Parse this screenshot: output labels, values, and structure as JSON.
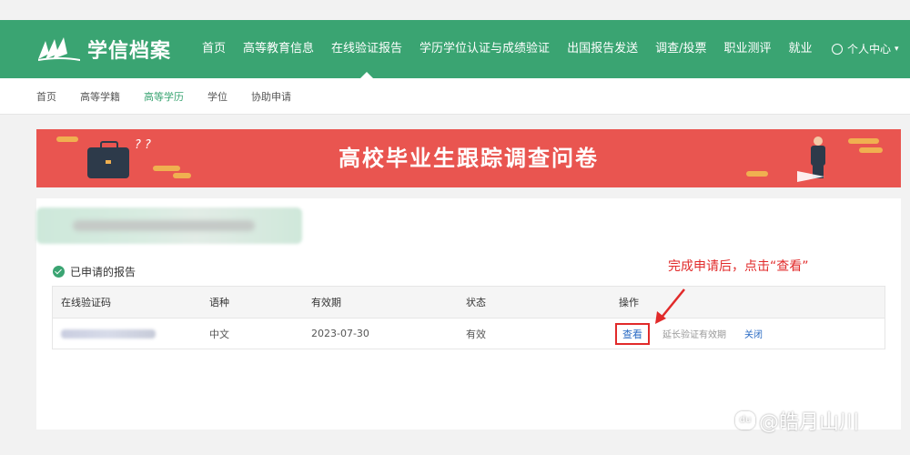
{
  "header": {
    "logo_text": "学信档案",
    "nav": [
      "首页",
      "高等教育信息",
      "在线验证报告",
      "学历学位认证与成绩验证",
      "出国报告发送",
      "调查/投票",
      "职业测评",
      "就业"
    ],
    "active_nav_index": 2,
    "user_label": "个人中心"
  },
  "subnav": {
    "items": [
      "首页",
      "高等学籍",
      "高等学历",
      "学位",
      "协助申请"
    ],
    "active_index": 2
  },
  "banner": {
    "title": "高校毕业生跟踪调查问卷",
    "qmarks": "? ?"
  },
  "reports": {
    "section_title": "已申请的报告",
    "columns": [
      "在线验证码",
      "语种",
      "有效期",
      "状态",
      "操作"
    ],
    "rows": [
      {
        "language": "中文",
        "expiry": "2023-07-30",
        "status": "有效",
        "view_label": "查看",
        "extend_label": "延长验证有效期",
        "close_label": "关闭"
      }
    ]
  },
  "annotation": {
    "text": "完成申请后，点击“查看”",
    "color": "#e12a2a"
  },
  "watermark": {
    "icon": "du",
    "text": "@皓月山川"
  },
  "colors": {
    "brand_green": "#3aa472",
    "banner_red": "#e95550",
    "link_blue": "#2a6bc4"
  },
  "icons": {
    "logo": "book-logo-icon",
    "user": "user-circle-icon",
    "check": "check-circle-icon",
    "arrow": "annotation-arrow-icon"
  }
}
